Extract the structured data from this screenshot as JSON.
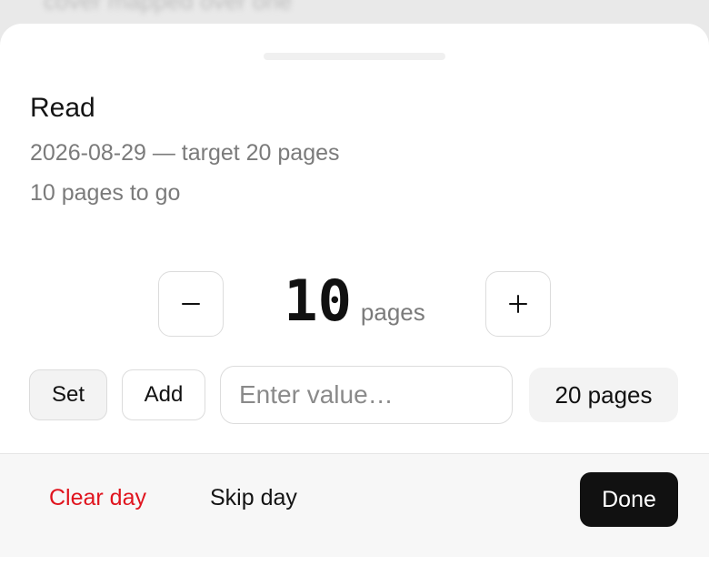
{
  "background": {
    "blurred_text": "cover mapped over one"
  },
  "sheet": {
    "title": "Read",
    "subtitle": "2026-08-29 — target 20 pages",
    "remaining": "10 pages to go"
  },
  "stepper": {
    "value": "10",
    "unit": "pages",
    "decrement_icon": "minus-icon",
    "increment_icon": "plus-icon"
  },
  "controls": {
    "set_label": "Set",
    "add_label": "Add",
    "input_placeholder": "Enter value…",
    "input_value": "",
    "target_label": "20 pages"
  },
  "footer": {
    "clear_label": "Clear day",
    "skip_label": "Skip day",
    "done_label": "Done"
  },
  "colors": {
    "danger": "#e0141e",
    "primary": "#111111"
  }
}
